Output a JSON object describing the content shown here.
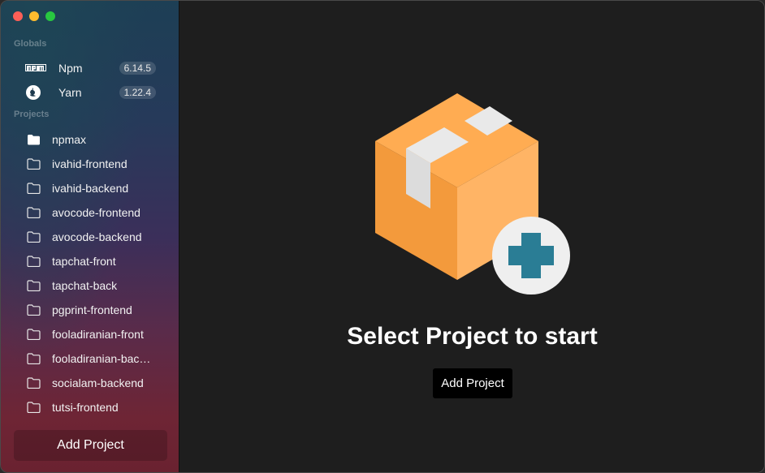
{
  "sidebar": {
    "globals_label": "Globals",
    "globals": [
      {
        "label": "Npm",
        "version": "6.14.5",
        "icon": "npm-icon"
      },
      {
        "label": "Yarn",
        "version": "1.22.4",
        "icon": "yarn-icon"
      }
    ],
    "projects_label": "Projects",
    "projects": [
      {
        "label": "npmax",
        "selected": true
      },
      {
        "label": "ivahid-frontend"
      },
      {
        "label": "ivahid-backend"
      },
      {
        "label": "avocode-frontend"
      },
      {
        "label": "avocode-backend"
      },
      {
        "label": "tapchat-front"
      },
      {
        "label": "tapchat-back"
      },
      {
        "label": "pgprint-frontend"
      },
      {
        "label": "fooladiranian-front"
      },
      {
        "label": "fooladiranian-bac…"
      },
      {
        "label": "socialam-backend"
      },
      {
        "label": "tutsi-frontend"
      }
    ],
    "add_label": "Add Project"
  },
  "main": {
    "title": "Select Project to start",
    "add_label": "Add Project",
    "illustration": "box-with-plus-icon"
  },
  "colors": {
    "box_orange": "#ffa64d",
    "plus_teal": "#2a7d95"
  }
}
